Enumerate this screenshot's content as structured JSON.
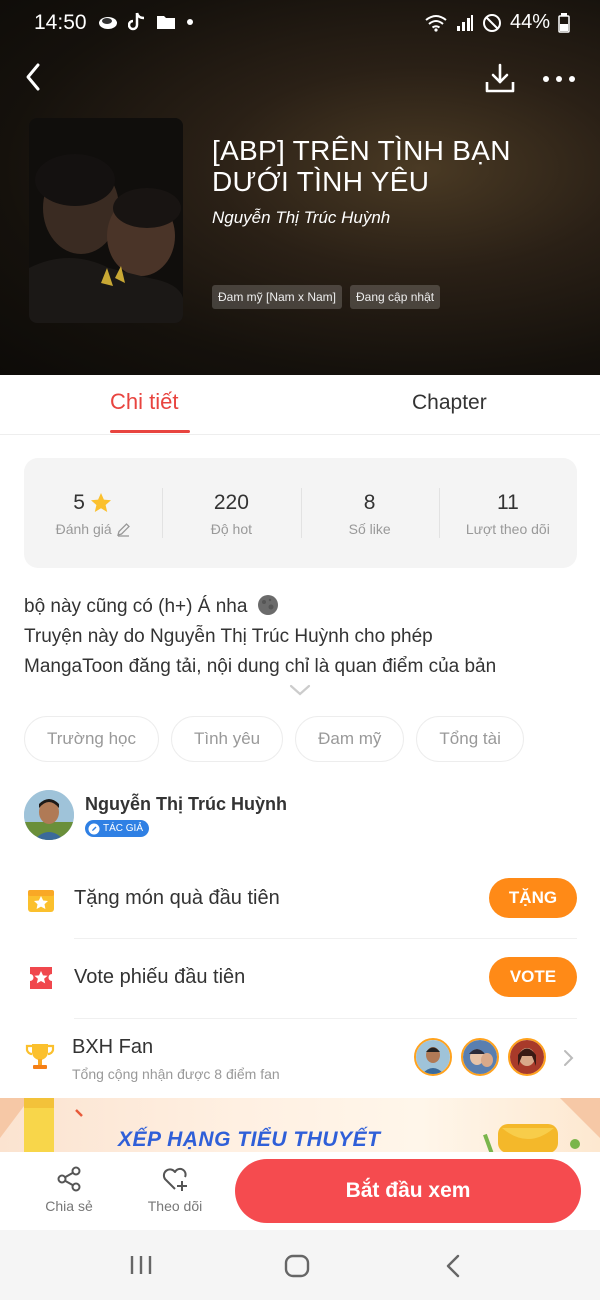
{
  "status_bar": {
    "time": "14:50",
    "battery": "44%"
  },
  "book": {
    "title_line1": "[ABP] TRÊN TÌNH BẠN",
    "title_line2": "DƯỚI TÌNH YÊU",
    "author": "Nguyễn Thị Trúc Huỳnh",
    "tags": [
      "Đam mỹ [Nam x Nam]",
      "Đang cập nhật"
    ]
  },
  "tabs": {
    "detail": "Chi tiết",
    "chapter": "Chapter"
  },
  "stats": [
    {
      "value": "5",
      "label": "Đánh giá"
    },
    {
      "value": "220",
      "label": "Độ hot"
    },
    {
      "value": "8",
      "label": "Số like"
    },
    {
      "value": "11",
      "label": "Lượt theo dõi"
    }
  ],
  "description": {
    "line1": "bộ này cũng có (h+) Á nha",
    "line2": "Truyện này do Nguyễn Thị Trúc Huỳnh cho phép",
    "line3": "MangaToon đăng tải, nội dung chỉ là quan điểm của bản"
  },
  "genres": [
    "Trường học",
    "Tình yêu",
    "Đam mỹ",
    "Tổng tài"
  ],
  "author_section": {
    "name": "Nguyễn Thị Trúc Huỳnh",
    "badge": "TÁC GIẢ"
  },
  "gift_row": {
    "label": "Tặng món quà đầu tiên",
    "button": "TẶNG"
  },
  "vote_row": {
    "label": "Vote phiếu đầu tiên",
    "button": "VOTE"
  },
  "fan_rank": {
    "title": "BXH Fan",
    "subtitle": "Tổng cộng nhận được 8 điểm fan"
  },
  "banner": {
    "text": "XẾP HẠNG TIỂU THUYẾT"
  },
  "bottom_bar": {
    "share": "Chia sẻ",
    "follow": "Theo dõi",
    "start": "Bắt đầu xem"
  },
  "colors": {
    "accent": "#e8443f",
    "orange": "#ff8a17",
    "start_button": "#f54b4f",
    "author_badge": "#2f80e4"
  },
  "icons": [
    "back-icon",
    "download-icon",
    "more-icon",
    "star-icon",
    "edit-icon",
    "gift-icon",
    "ticket-icon",
    "trophy-icon",
    "share-icon",
    "heart-plus-icon"
  ]
}
